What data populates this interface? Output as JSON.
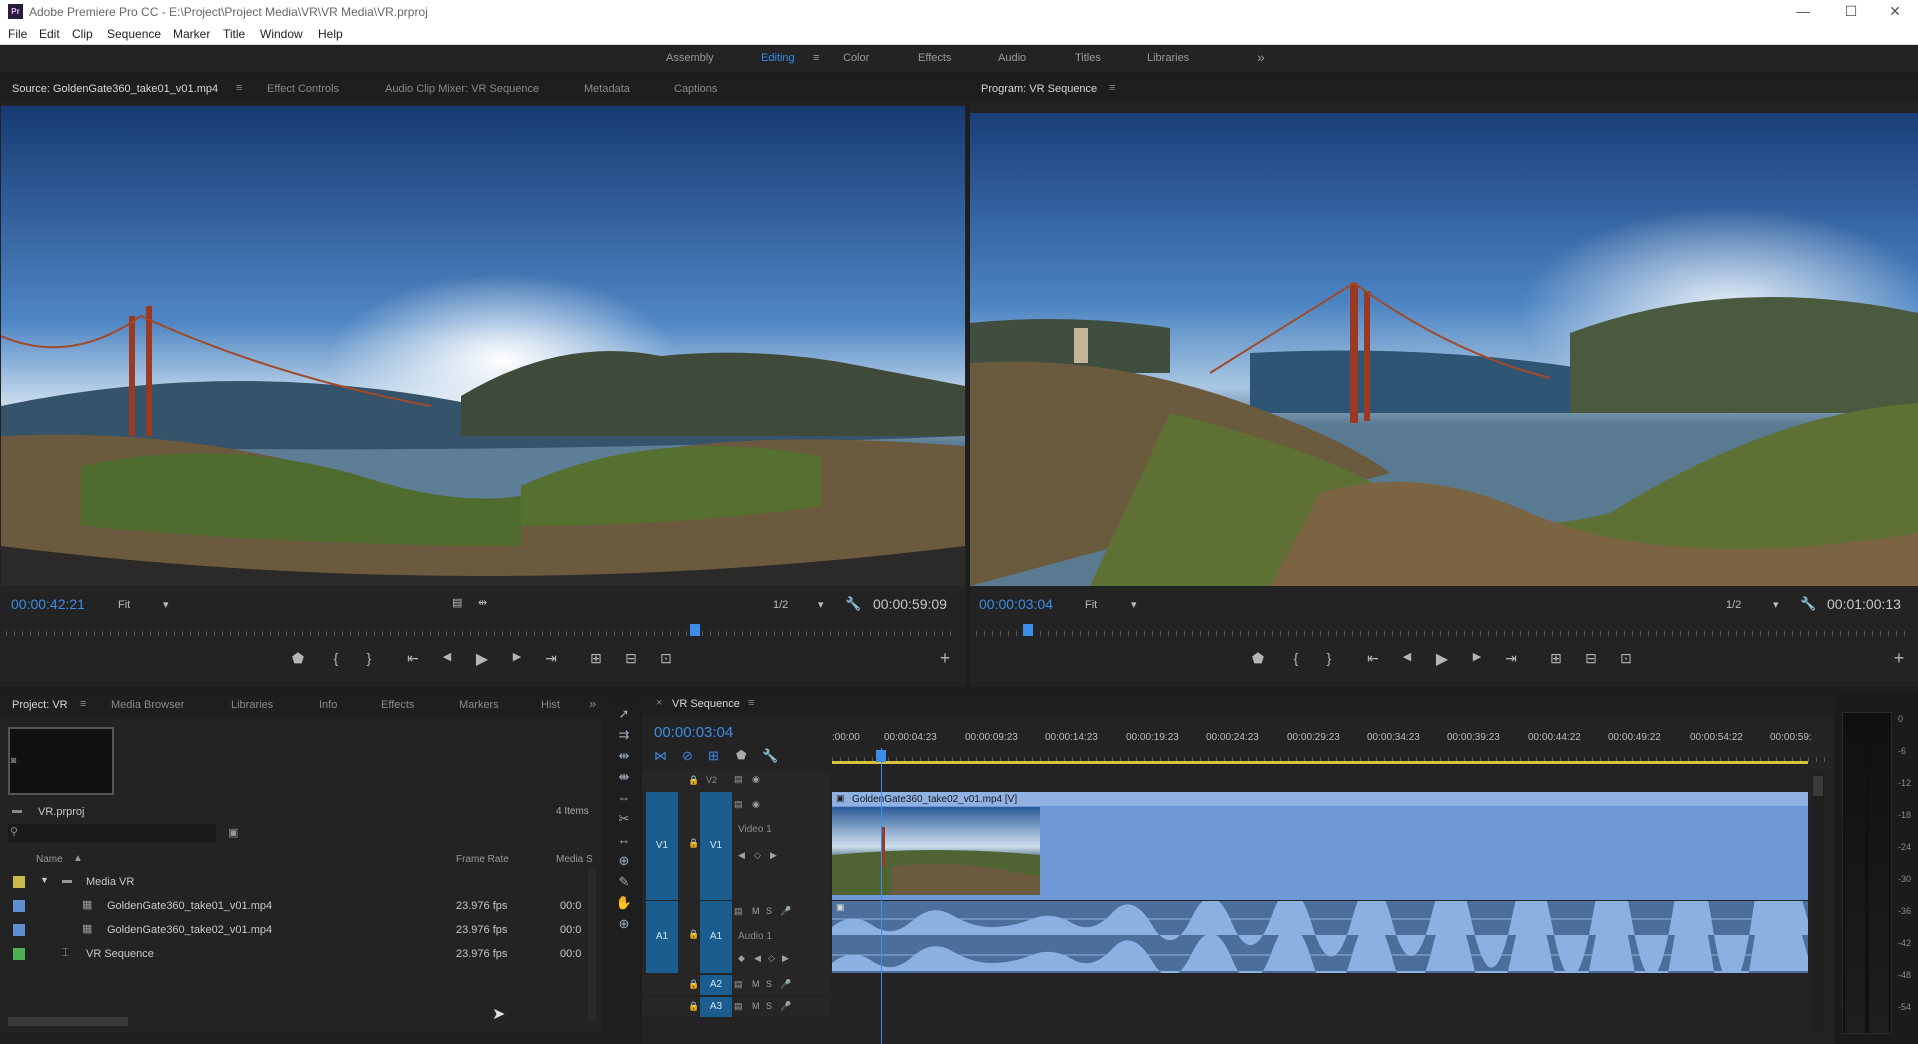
{
  "window": {
    "app_icon": "Pr",
    "title": "Adobe Premiere Pro CC - E:\\Project\\Project Media\\VR\\VR Media\\VR.prproj",
    "controls": [
      "—",
      "☐",
      "✕"
    ]
  },
  "menu": [
    "File",
    "Edit",
    "Clip",
    "Sequence",
    "Marker",
    "Title",
    "Window",
    "Help"
  ],
  "workspaces": {
    "items": [
      "Assembly",
      "Editing",
      "Color",
      "Effects",
      "Audio",
      "Titles",
      "Libraries"
    ],
    "active": "Editing",
    "overflow": "»",
    "menu_glyph": "≡"
  },
  "source_monitor": {
    "tabs": [
      "Source: GoldenGate360_take01_v01.mp4",
      "Effect Controls",
      "Audio Clip Mixer: VR Sequence",
      "Metadata",
      "Captions"
    ],
    "timecode": "00:00:42:21",
    "fit": "Fit",
    "resolution": "1/2",
    "duration": "00:00:59:09",
    "playhead_fraction": 0.72
  },
  "program_monitor": {
    "tab": "Program: VR Sequence",
    "timecode": "00:00:03:04",
    "fit": "Fit",
    "resolution": "1/2",
    "duration": "00:01:00:13",
    "playhead_fraction": 0.05
  },
  "transport_icons": [
    "marker-icon",
    "mark-in-icon",
    "mark-out-icon",
    "go-to-in-icon",
    "step-back-icon",
    "play-icon",
    "step-forward-icon",
    "go-to-out-icon",
    "insert-icon",
    "overwrite-icon",
    "export-frame-icon"
  ],
  "transport_glyphs": [
    "⬟",
    "{",
    "}",
    "⇤",
    "◀",
    "▶",
    "▶",
    "⇥",
    "⊞",
    "⊟",
    "⊡"
  ],
  "add_glyph": "+",
  "project_panel": {
    "tabs": [
      "Project: VR",
      "Media Browser",
      "Libraries",
      "Info",
      "Effects",
      "Markers",
      "Hist"
    ],
    "overflow": "»",
    "project_name": "VR.prproj",
    "item_count": "4 Items",
    "columns": [
      "Name",
      "Frame Rate",
      "Media S"
    ],
    "rows": [
      {
        "name": "Media VR",
        "frame_rate": "",
        "media": "",
        "color": "#c9b84a",
        "indent": 0,
        "type": "bin"
      },
      {
        "name": "GoldenGate360_take01_v01.mp4",
        "frame_rate": "23.976 fps",
        "media": "00:0",
        "color": "#5d8fd0",
        "indent": 1,
        "type": "clip"
      },
      {
        "name": "GoldenGate360_take02_v01.mp4",
        "frame_rate": "23.976 fps",
        "media": "00:0",
        "color": "#5d8fd0",
        "indent": 1,
        "type": "clip"
      },
      {
        "name": "VR Sequence",
        "frame_rate": "23.976 fps",
        "media": "00:0",
        "color": "#4caf50",
        "indent": 0,
        "type": "sequence"
      }
    ]
  },
  "timeline": {
    "tab": "VR Sequence",
    "close_glyph": "×",
    "timecode": "00:00:03:04",
    "ruler_labels": [
      ":00:00",
      "00:00:04:23",
      "00:00:09:23",
      "00:00:14:23",
      "00:00:19:23",
      "00:00:24:23",
      "00:00:29:23",
      "00:00:34:23",
      "00:00:39:23",
      "00:00:44:22",
      "00:00:49:22",
      "00:00:54:22",
      "00:00:59:"
    ],
    "tracks": {
      "v2": "V2",
      "v1_src": "V1",
      "v1": "V1",
      "video1_name": "Video 1",
      "a1_src": "A1",
      "a1": "A1",
      "audio1_name": "Audio 1",
      "a2": "A2",
      "a3": "A3",
      "mute": "M",
      "solo": "S"
    },
    "clip_label": "GoldenGate360_take02_v01.mp4 [V]",
    "playhead_fraction": 0.05
  },
  "audio_meter": {
    "scale": [
      "0",
      "-6",
      "-12",
      "-18",
      "-24",
      "-30",
      "-36",
      "-42",
      "-48",
      "-54"
    ]
  }
}
